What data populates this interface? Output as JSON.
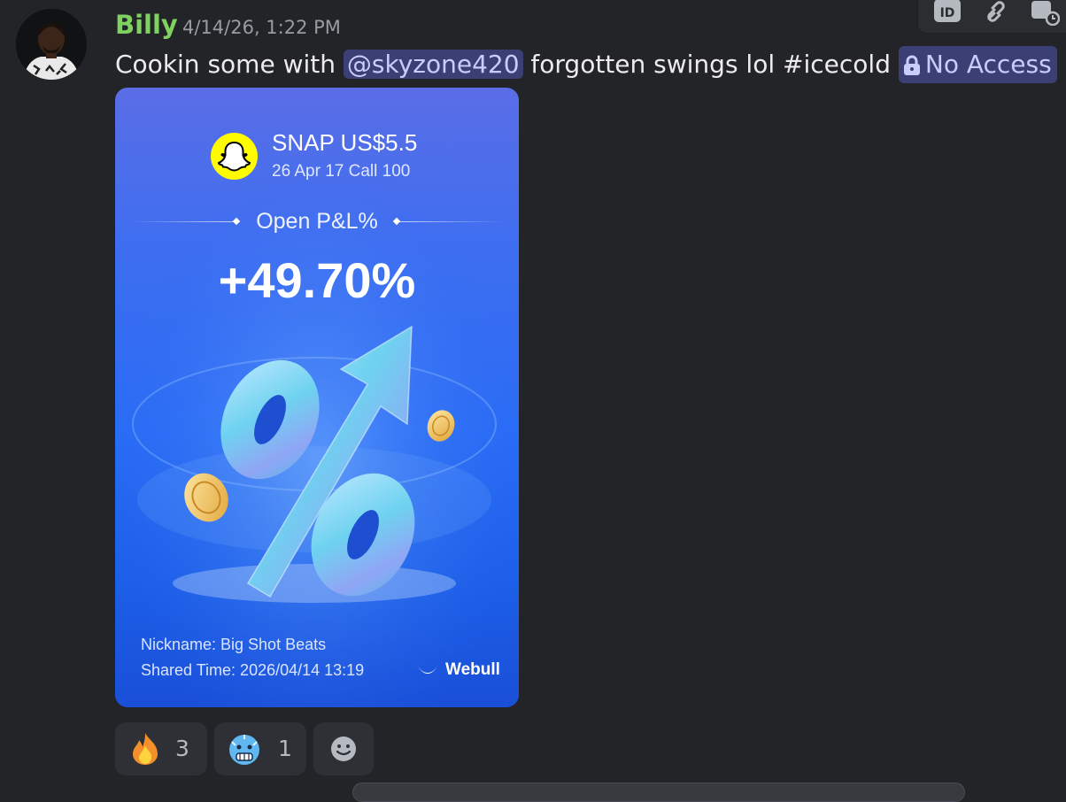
{
  "message": {
    "author": "Billy",
    "timestamp": "4/14/26, 1:22 PM",
    "text_before": "Cookin some with ",
    "mention": "@skyzone420",
    "text_after": " forgotten swings lol #icecold ",
    "channel_label": "No Access"
  },
  "toolbar": {
    "icons": [
      "id-icon",
      "link-icon",
      "reply-history-icon"
    ]
  },
  "card": {
    "ticker": "SNAP US$5.5",
    "contract": "26 Apr 17 Call 100",
    "pl_label": "Open P&L%",
    "pl_value": "+49.70%",
    "nickname": "Nickname: Big Shot Beats",
    "shared_time": "Shared Time: 2026/04/14 13:19",
    "brand": "Webull"
  },
  "reactions": [
    {
      "emoji": "fire",
      "count": "3"
    },
    {
      "emoji": "cold-face",
      "count": "1"
    }
  ],
  "colors": {
    "background": "#232428",
    "username": "#7fd160",
    "mention_bg": "#3b3f74",
    "mention_text": "#c9cdfb"
  }
}
